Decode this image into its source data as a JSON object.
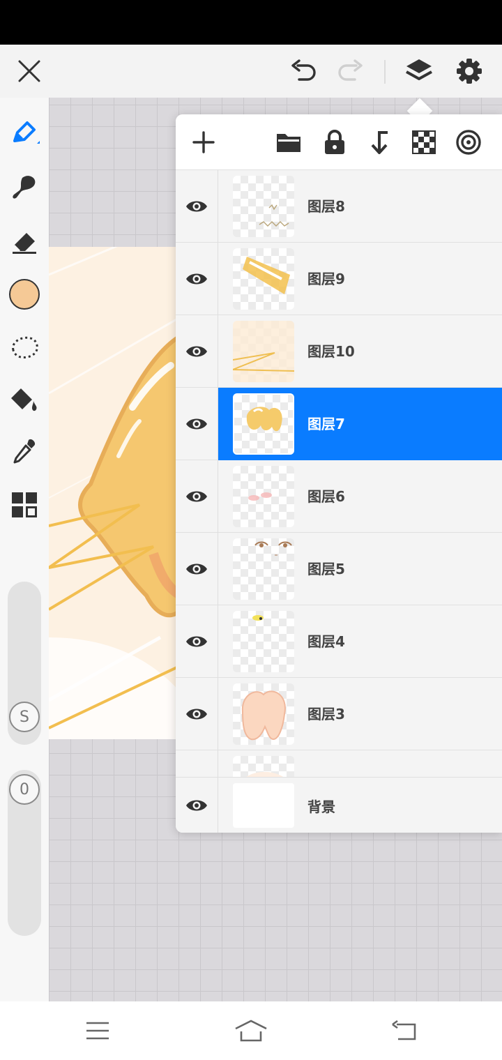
{
  "app": {
    "accent": "#0a7cff"
  },
  "topbar": {
    "icons": [
      "close-icon",
      "undo-icon",
      "redo-icon",
      "layers-icon",
      "settings-icon"
    ]
  },
  "left_toolbar": {
    "tools": [
      "pen-icon",
      "brush-icon",
      "eraser-icon",
      "color-swatch",
      "lasso-icon",
      "fill-bucket-icon",
      "eyedropper-icon",
      "grid-panels-icon"
    ],
    "current_color": "#f5c996",
    "size_badge": "S",
    "opacity_badge": "0"
  },
  "layer_panel": {
    "toolbar_icons": [
      "add-icon",
      "folder-icon",
      "lock-icon",
      "clipping-icon",
      "transparency-icon",
      "reference-icon"
    ],
    "layers": [
      {
        "name": "图层8",
        "selected": false
      },
      {
        "name": "图层9",
        "selected": false
      },
      {
        "name": "图层10",
        "selected": false
      },
      {
        "name": "图层7",
        "selected": true
      },
      {
        "name": "图层6",
        "selected": false
      },
      {
        "name": "图层5",
        "selected": false
      },
      {
        "name": "图层4",
        "selected": false
      },
      {
        "name": "图层3",
        "selected": false
      }
    ],
    "background_layer": {
      "name": "背景"
    }
  },
  "navbar": {
    "icons": [
      "menu-icon",
      "home-icon",
      "back-icon"
    ]
  }
}
